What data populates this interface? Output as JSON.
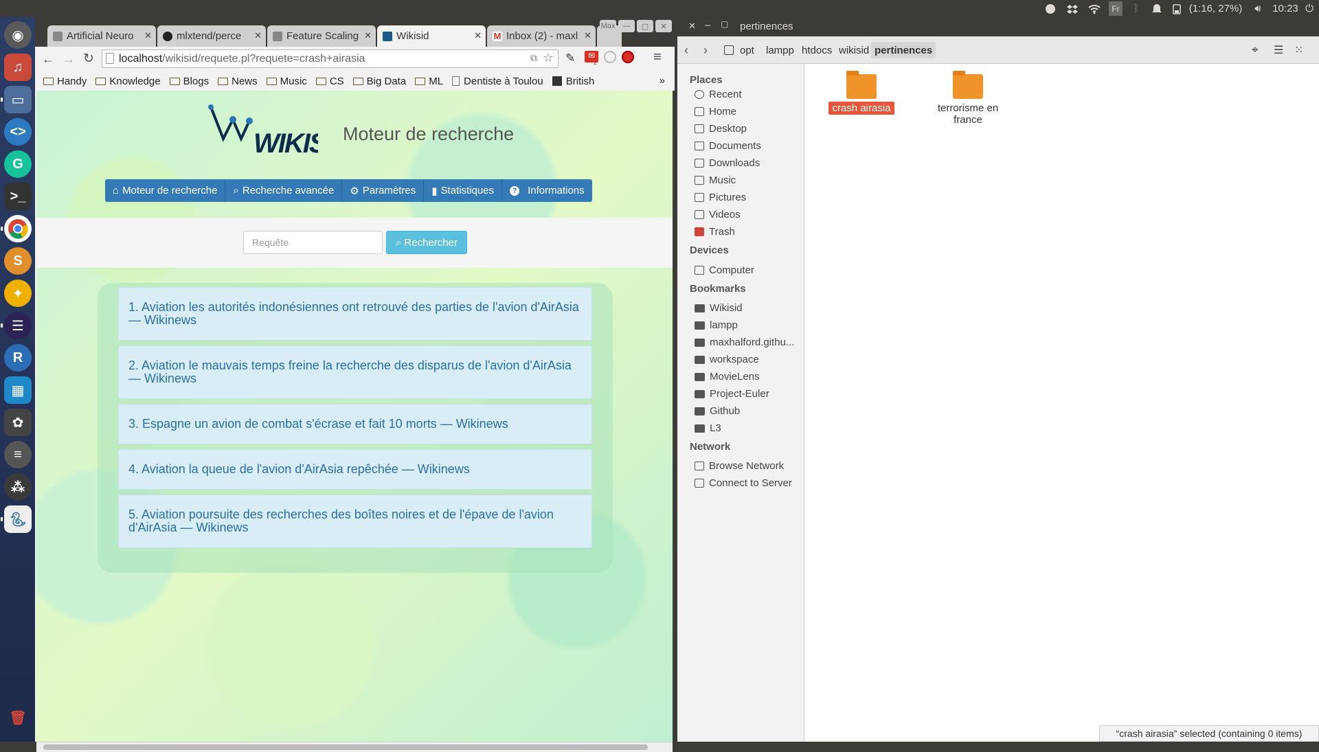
{
  "topbar": {
    "keyboard": "Fr",
    "battery": "(1:16, 27%)",
    "time": "10:23"
  },
  "launcher": {
    "items": [
      "ubuntu-dash",
      "rhythmbox",
      "files",
      "code-editor",
      "grammarly",
      "terminal",
      "chrome",
      "sublime-text",
      "bird-app",
      "eclipse",
      "r-studio",
      "monitor",
      "settings-app",
      "database",
      "atom-app",
      "python-app",
      "trash"
    ]
  },
  "browser": {
    "tabs": [
      {
        "label": "Artificial Neuro"
      },
      {
        "label": "mlxtend/perce"
      },
      {
        "label": "Feature Scaling"
      },
      {
        "label": "Wikisid"
      },
      {
        "label": "Inbox (2) - maxl"
      }
    ],
    "window_label": "Max",
    "url_host": "localhost",
    "url_path": "/wikisid/requete.pl?requete=crash+airasia",
    "gmail_badge": "2",
    "bookmarks": [
      "Handy",
      "Knowledge",
      "Blogs",
      "News",
      "Music",
      "CS",
      "Big Data",
      "ML",
      "Dentiste à Toulou",
      "British"
    ],
    "more": "»"
  },
  "page": {
    "logo_text": "WIKISID",
    "subtitle": "Moteur de recherche",
    "menu": [
      "Moteur de recherche",
      "Recherche avancée",
      "Paramètres",
      "Statistiques",
      "Informations"
    ],
    "search_placeholder": "Requête",
    "search_button": "Rechercher",
    "results": [
      "1. Aviation les autorités indonésiennes ont retrouvé des parties de l'avion d'AirAsia — Wikinews",
      "2. Aviation le mauvais temps freine la recherche des disparus de l'avion d'AirAsia — Wikinews",
      "3. Espagne un avion de combat s'écrase et fait 10 morts — Wikinews",
      "4. Aviation la queue de l'avion d'AirAsia repêchée — Wikinews",
      "5. Aviation poursuite des recherches des boîtes noires et de l'épave de l'avion d'AirAsia — Wikinews"
    ]
  },
  "files": {
    "title": "pertinences",
    "path": [
      "opt",
      "lampp",
      "htdocs",
      "wikisid",
      "pertinences"
    ],
    "places_header": "Places",
    "places": [
      "Recent",
      "Home",
      "Desktop",
      "Documents",
      "Downloads",
      "Music",
      "Pictures",
      "Videos",
      "Trash"
    ],
    "devices_header": "Devices",
    "devices": [
      "Computer"
    ],
    "bookmarks_header": "Bookmarks",
    "bookmarks": [
      "Wikisid",
      "lampp",
      "maxhalford.githu...",
      "workspace",
      "MovieLens",
      "Project-Euler",
      "Github",
      "L3"
    ],
    "network_header": "Network",
    "network": [
      "Browse Network",
      "Connect to Server"
    ],
    "items": [
      "crash airasia",
      "terrorisme en france"
    ],
    "status": "“crash airasia” selected  (containing 0 items)"
  }
}
